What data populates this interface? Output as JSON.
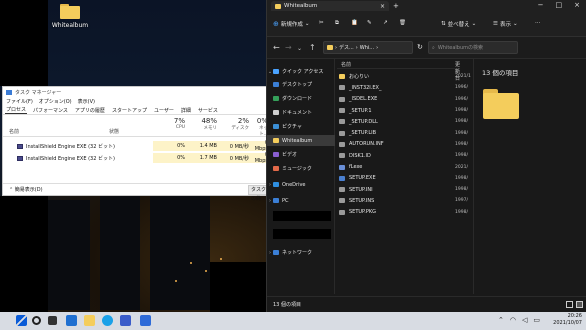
{
  "desktop": {
    "icon_label": "Whitealbum"
  },
  "taskmgr": {
    "title": "タスク マネージャー",
    "menu": [
      "ファイル(F)",
      "オプション(O)",
      "表示(V)"
    ],
    "tabs": [
      "プロセス",
      "パフォーマンス",
      "アプリの履歴",
      "スタートアップ",
      "ユーザー",
      "詳細",
      "サービス"
    ],
    "col_name": "名前",
    "col_status": "状態",
    "cpu": {
      "pct": "7%",
      "label": "CPU"
    },
    "mem": {
      "pct": "48%",
      "label": "メモリ"
    },
    "disk": {
      "pct": "2%",
      "label": "ディスク"
    },
    "net": {
      "pct": "0%",
      "label": "ネット..."
    },
    "rows": [
      {
        "name": "InstallShield Engine EXE (32 ビット)",
        "cpu": "0%",
        "mem": "1.4 MB",
        "disk": "0 MB/秒",
        "net": "0 Mbps"
      },
      {
        "name": "InstallShield Engine EXE (32 ビット)",
        "cpu": "0%",
        "mem": "1.7 MB",
        "disk": "0 MB/秒",
        "net": "0 Mbps"
      }
    ],
    "less": "簡易表示(D)",
    "end_task": "タスクの終"
  },
  "explorer": {
    "tab_title": "Whitealbum",
    "new_label": "新規作成",
    "sort_label": "並べ替え",
    "view_label": "表示",
    "addr_parts": [
      "デス...",
      "Whi..."
    ],
    "search_placeholder": "Whitealbumの検索",
    "nav": [
      {
        "label": "クイック アクセス",
        "color": "#4aa3ff"
      },
      {
        "label": "デスクトップ",
        "color": "#3b7fd6"
      },
      {
        "label": "ダウンロード",
        "color": "#35a05a"
      },
      {
        "label": "ドキュメント",
        "color": "#cfcfcf"
      },
      {
        "label": "ピクチャ",
        "color": "#3b8fd6"
      },
      {
        "label": "Whitealbum",
        "color": "#f4cd5c"
      },
      {
        "label": "ビデオ",
        "color": "#8a5fd1"
      },
      {
        "label": "ミュージック",
        "color": "#e36a4a"
      },
      {
        "label": "OneDrive",
        "color": "#2f8fe0"
      },
      {
        "label": "PC",
        "color": "#3b7fd6"
      },
      {
        "label": "ネットワーク",
        "color": "#3b7fd6"
      }
    ],
    "col_name": "名前",
    "col_date": "更新日",
    "files": [
      {
        "name": "お心りい",
        "date": "2021/1",
        "color": "#f4cd5c"
      },
      {
        "name": "_INST32I.EX_",
        "date": "1996/",
        "color": "#9a9a9a"
      },
      {
        "name": "_ISDEL.EXE",
        "date": "1996/",
        "color": "#9a9a9a"
      },
      {
        "name": "_SETUP.1",
        "date": "1998/",
        "color": "#9a9a9a"
      },
      {
        "name": "_SETUP.DLL",
        "date": "1998/",
        "color": "#9a9a9a"
      },
      {
        "name": "_SETUP.LIB",
        "date": "1998/",
        "color": "#9a9a9a"
      },
      {
        "name": "AUTORUN.INF",
        "date": "1998/",
        "color": "#9a9a9a"
      },
      {
        "name": "DISK1.ID",
        "date": "1998/",
        "color": "#9a9a9a"
      },
      {
        "name": "fLexe",
        "date": "2021/",
        "color": "#6a8fd8"
      },
      {
        "name": "SETUP.EXE",
        "date": "1998/",
        "color": "#4a7fd0"
      },
      {
        "name": "SETUP.INI",
        "date": "1998/",
        "color": "#9a9a9a"
      },
      {
        "name": "SETUP.INS",
        "date": "1997/",
        "color": "#9a9a9a"
      },
      {
        "name": "SETUP.PKG",
        "date": "1998/",
        "color": "#9a9a9a"
      }
    ],
    "preview_title": "13 個の項目",
    "status": "13 個の項目"
  },
  "taskbar": {
    "time": "20:26",
    "date": "2021/10/07"
  }
}
